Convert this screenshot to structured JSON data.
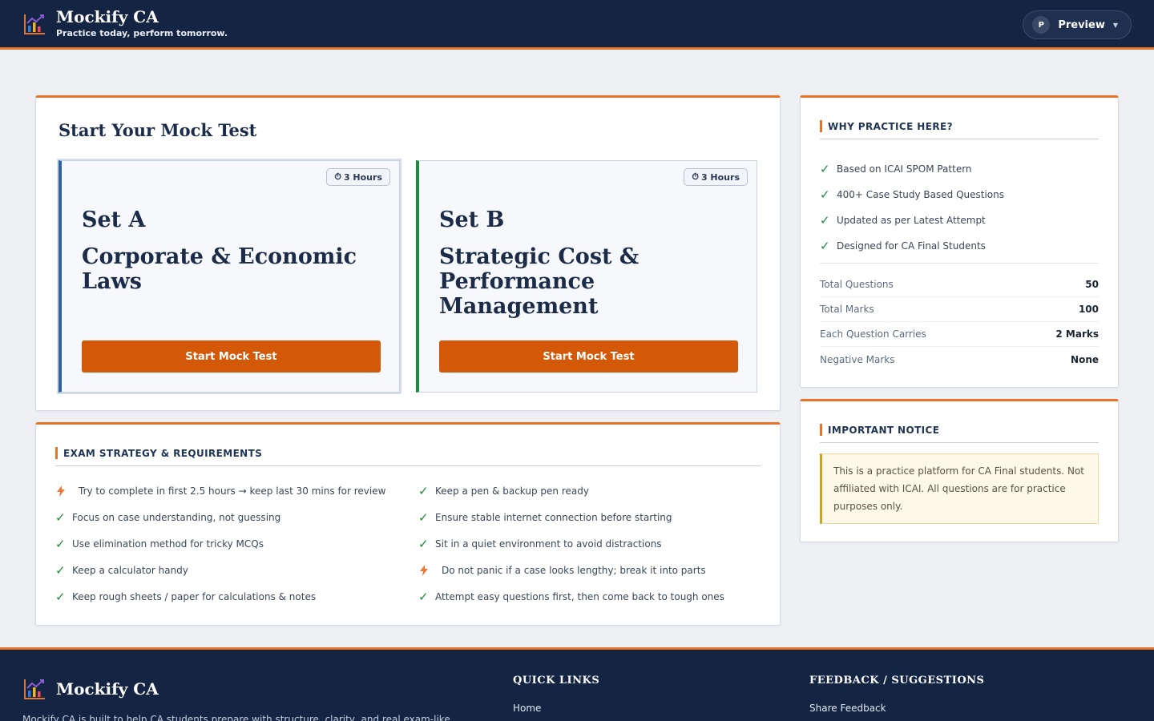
{
  "header": {
    "app_name": "Mockify CA",
    "tagline": "Practice today, perform tomorrow.",
    "preview_avatar": "P",
    "preview_label": "Preview"
  },
  "mock": {
    "title": "Start Your Mock Test",
    "sets": [
      {
        "duration": "3 Hours",
        "name": "Set A",
        "subject": "Corporate & Economic Laws",
        "button": "Start Mock Test",
        "accent": "#2e5fa7"
      },
      {
        "duration": "3 Hours",
        "name": "Set B",
        "subject": "Strategic Cost & Performance Management",
        "button": "Start Mock Test",
        "accent": "#1e8a3c"
      }
    ]
  },
  "why": {
    "heading": "WHY PRACTICE HERE?",
    "points": [
      "Based on ICAI SPOM Pattern",
      "400+ Case Study Based Questions",
      "Updated as per Latest Attempt",
      "Designed for CA Final Students"
    ],
    "stats": [
      {
        "label": "Total Questions",
        "value": "50"
      },
      {
        "label": "Total Marks",
        "value": "100"
      },
      {
        "label": "Each Question Carries",
        "value": "2 Marks"
      },
      {
        "label": "Negative Marks",
        "value": "None"
      }
    ]
  },
  "notice": {
    "heading": "IMPORTANT NOTICE",
    "text": "This is a practice platform for CA Final students. Not affiliated with ICAI. All questions are for practice purposes only."
  },
  "strategy": {
    "heading": "EXAM STRATEGY & REQUIREMENTS",
    "left": [
      {
        "icon": "bolt",
        "text": "Try to complete in first 2.5 hours → keep last 30 mins for review"
      },
      {
        "icon": "check",
        "text": "Focus on case understanding, not guessing"
      },
      {
        "icon": "check",
        "text": "Use elimination method for tricky MCQs"
      },
      {
        "icon": "check",
        "text": "Keep a calculator handy"
      },
      {
        "icon": "check",
        "text": "Keep rough sheets / paper for calculations & notes"
      }
    ],
    "right": [
      {
        "icon": "check",
        "text": "Keep a pen & backup pen ready"
      },
      {
        "icon": "check",
        "text": "Ensure stable internet connection before starting"
      },
      {
        "icon": "check",
        "text": "Sit in a quiet environment to avoid distractions"
      },
      {
        "icon": "bolt",
        "text": "Do not panic if a case looks lengthy; break it into parts"
      },
      {
        "icon": "check",
        "text": "Attempt easy questions first, then come back to tough ones"
      }
    ]
  },
  "footer": {
    "app_name": "Mockify CA",
    "description": "Mockify CA is built to help CA students prepare with structure, clarity, and real exam-like",
    "quick_links_title": "QUICK LINKS",
    "quick_links": [
      "Home"
    ],
    "feedback_title": "FEEDBACK / SUGGESTIONS",
    "feedback_links": [
      "Share Feedback"
    ]
  },
  "colors": {
    "navy": "#142443",
    "accent_orange": "#e8742a",
    "button_orange": "#d35908",
    "check_green": "#1e8a3c"
  }
}
